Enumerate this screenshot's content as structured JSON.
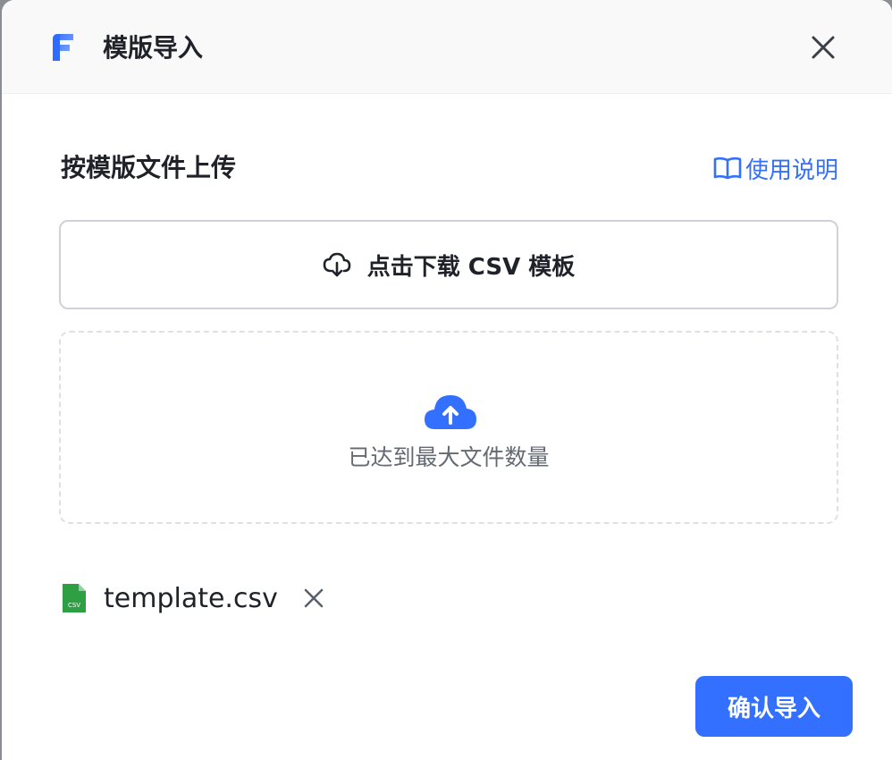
{
  "dialog": {
    "title": "模版导入",
    "logo_icon": "brand-f-logo-icon",
    "close_icon": "close-icon"
  },
  "section": {
    "title": "按模版文件上传",
    "help_label": "使用说明",
    "help_icon": "book-icon"
  },
  "download": {
    "label": "点击下载 CSV 模板",
    "icon": "cloud-download-icon"
  },
  "dropzone": {
    "message": "已达到最大文件数量",
    "icon": "cloud-upload-icon"
  },
  "file": {
    "name": "template.csv",
    "icon_text": "CSV",
    "icon": "csv-file-icon",
    "remove_icon": "close-icon"
  },
  "footer": {
    "confirm_label": "确认导入"
  },
  "colors": {
    "primary": "#3370ff",
    "file_icon": "#2ea043",
    "text": "#1f2329",
    "muted": "#646a73"
  }
}
